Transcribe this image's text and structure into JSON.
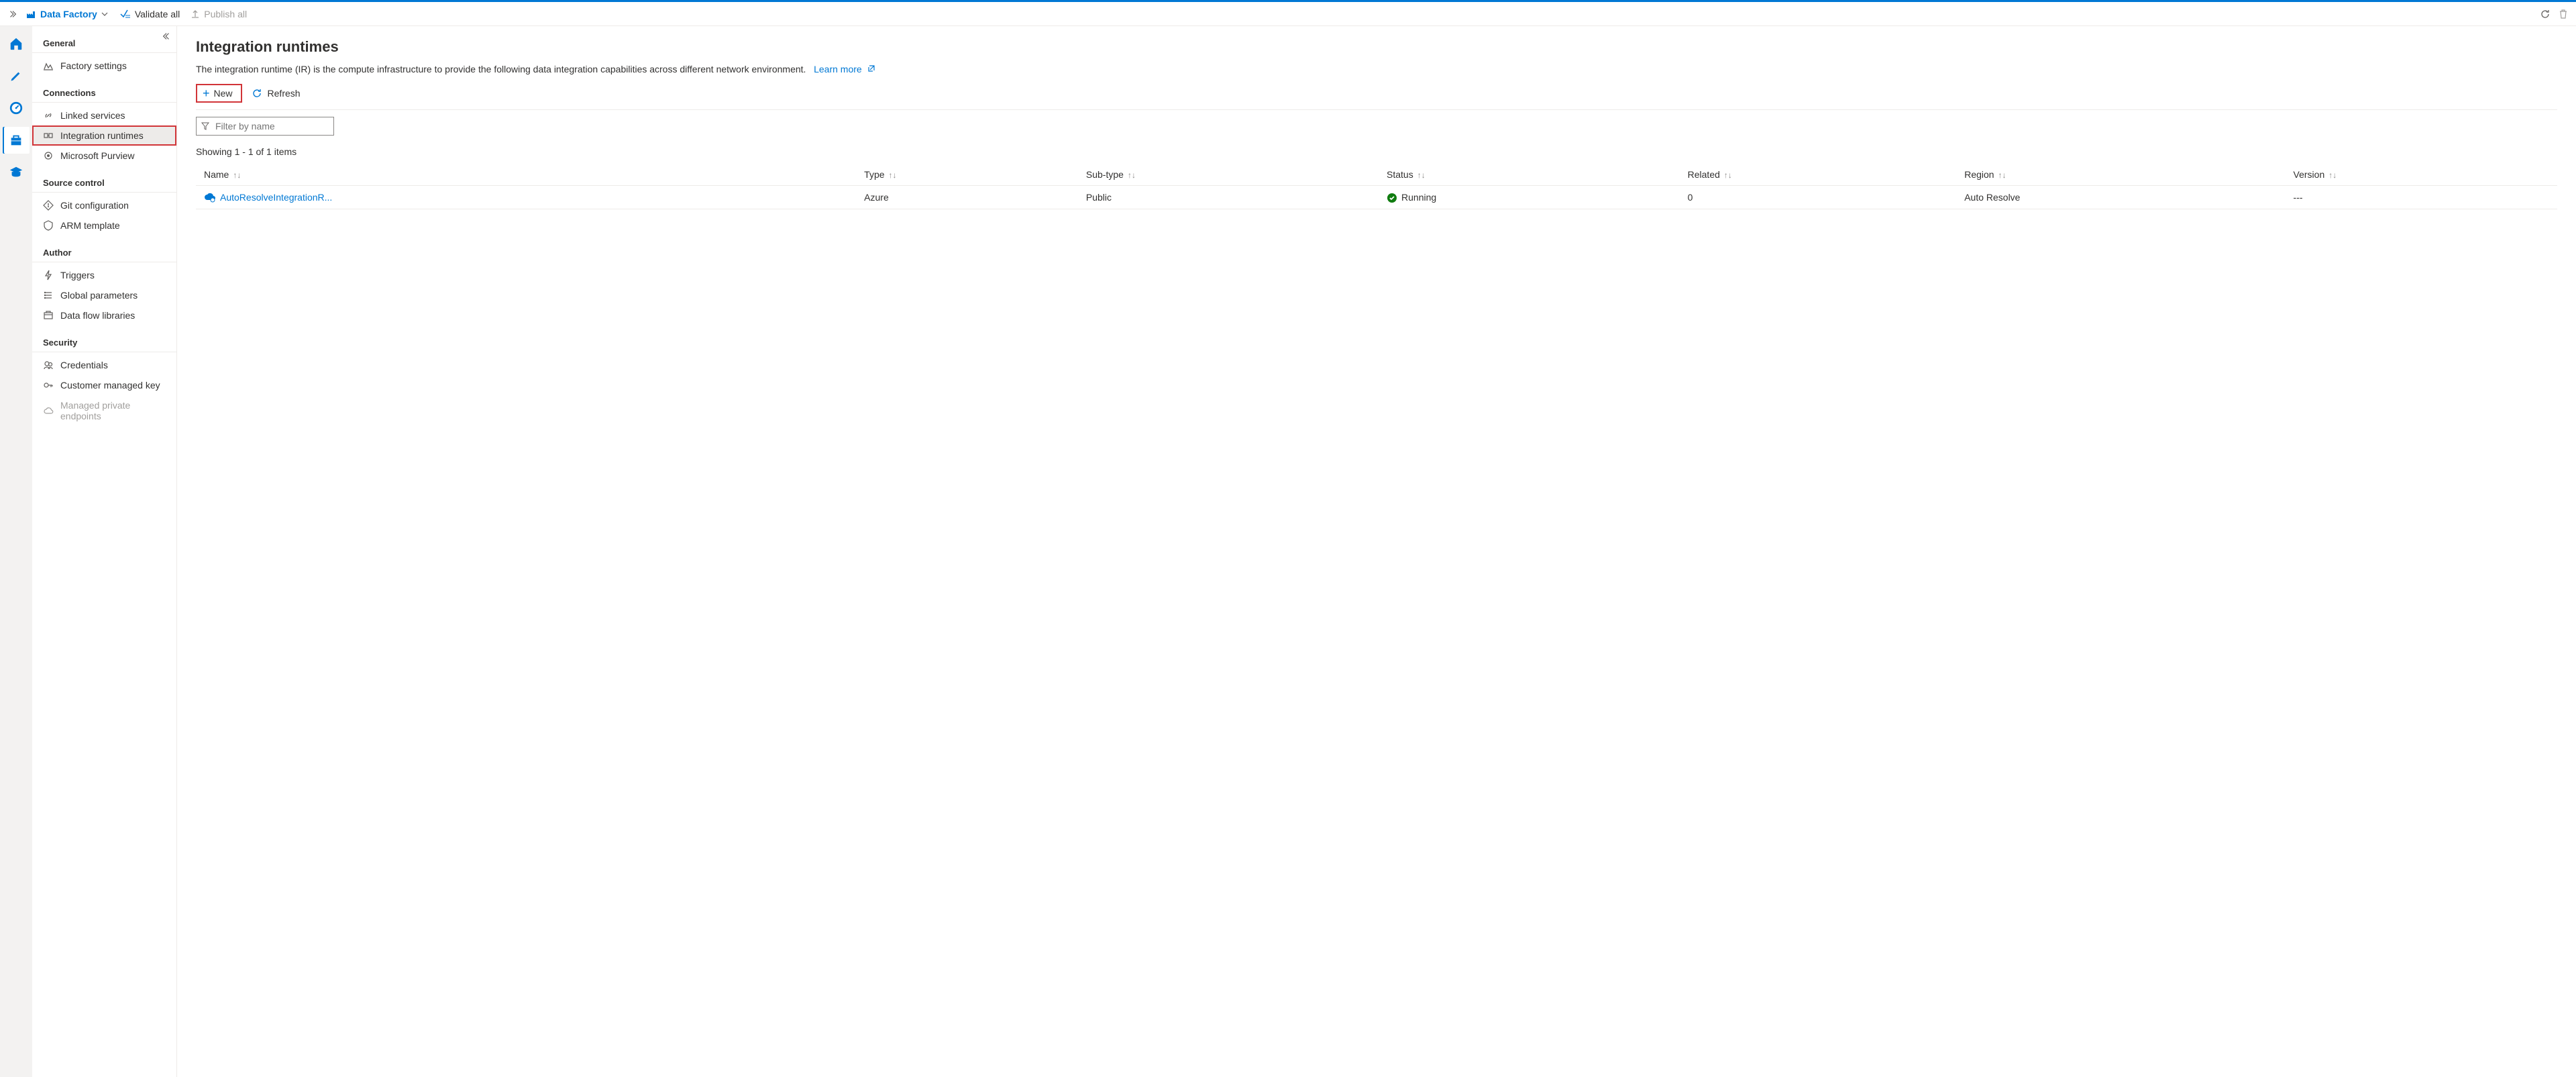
{
  "topbar": {
    "breadcrumb": "Data Factory",
    "validate_all": "Validate all",
    "publish_all": "Publish all"
  },
  "rail": [
    {
      "id": "home",
      "icon": "home",
      "active": false
    },
    {
      "id": "author",
      "icon": "pencil",
      "active": false
    },
    {
      "id": "monitor",
      "icon": "gauge",
      "active": false
    },
    {
      "id": "manage",
      "icon": "toolbox",
      "active": true
    },
    {
      "id": "learning",
      "icon": "hat",
      "active": false
    }
  ],
  "sidebar": {
    "groups": [
      {
        "header": "General",
        "items": [
          {
            "id": "factory-settings",
            "label": "Factory settings",
            "icon": "settings"
          }
        ]
      },
      {
        "header": "Connections",
        "items": [
          {
            "id": "linked-services",
            "label": "Linked services",
            "icon": "link"
          },
          {
            "id": "integration-runtimes",
            "label": "Integration runtimes",
            "icon": "runtime",
            "selected": true
          },
          {
            "id": "microsoft-purview",
            "label": "Microsoft Purview",
            "icon": "purview"
          }
        ]
      },
      {
        "header": "Source control",
        "items": [
          {
            "id": "git-config",
            "label": "Git configuration",
            "icon": "git"
          },
          {
            "id": "arm-template",
            "label": "ARM template",
            "icon": "arm"
          }
        ]
      },
      {
        "header": "Author",
        "items": [
          {
            "id": "triggers",
            "label": "Triggers",
            "icon": "trigger"
          },
          {
            "id": "global-params",
            "label": "Global parameters",
            "icon": "params"
          },
          {
            "id": "data-flow-libs",
            "label": "Data flow libraries",
            "icon": "libs"
          }
        ]
      },
      {
        "header": "Security",
        "items": [
          {
            "id": "credentials",
            "label": "Credentials",
            "icon": "creds"
          },
          {
            "id": "cmk",
            "label": "Customer managed key",
            "icon": "key"
          },
          {
            "id": "private-endpoints",
            "label": "Managed private endpoints",
            "icon": "cloud",
            "disabled": true
          }
        ]
      }
    ]
  },
  "page": {
    "title": "Integration runtimes",
    "description": "The integration runtime (IR) is the compute infrastructure to provide the following data integration capabilities across different network environment.",
    "learn_more": "Learn more",
    "new_label": "New",
    "refresh_label": "Refresh",
    "filter_placeholder": "Filter by name",
    "count_text": "Showing 1 - 1 of 1 items",
    "columns": [
      "Name",
      "Type",
      "Sub-type",
      "Status",
      "Related",
      "Region",
      "Version"
    ],
    "rows": [
      {
        "name": "AutoResolveIntegrationR...",
        "type": "Azure",
        "subtype": "Public",
        "status": "Running",
        "related": "0",
        "region": "Auto Resolve",
        "version": "---"
      }
    ]
  }
}
